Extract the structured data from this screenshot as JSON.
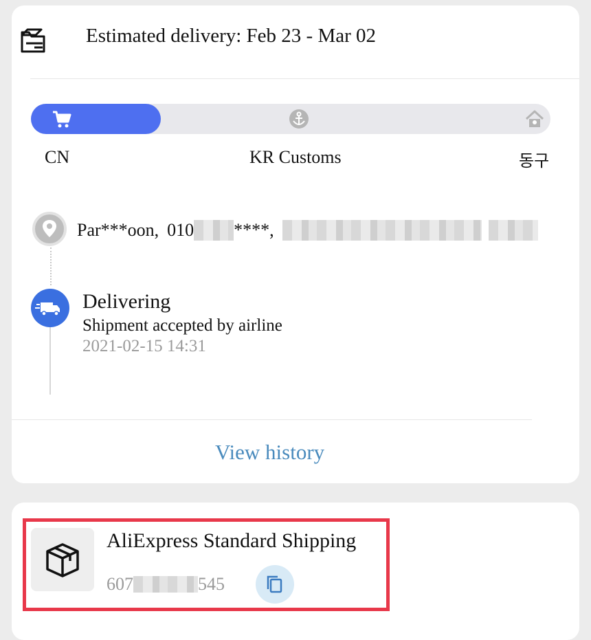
{
  "header": {
    "icon": "delivery-box-icon",
    "estimated_delivery": "Estimated delivery: Feb 23 - Mar 02"
  },
  "progress": {
    "fraction_complete": 0.25,
    "accent_color": "#4e6ff0",
    "stages": [
      {
        "label": "CN",
        "icon": "cart-icon"
      },
      {
        "label": "KR Customs",
        "icon": "anchor-icon"
      },
      {
        "label": "동구",
        "icon": "home-icon"
      }
    ]
  },
  "address": {
    "icon": "location-pin-icon",
    "name": "Par***oon,",
    "phone_prefix": "010",
    "phone_suffix": "****,"
  },
  "status": {
    "icon": "truck-icon",
    "title": "Delivering",
    "description": "Shipment accepted by airline",
    "timestamp": "2021-02-15 14:31"
  },
  "actions": {
    "view_history": "View history"
  },
  "shipping": {
    "icon": "package-icon",
    "method": "AliExpress Standard Shipping",
    "tracking_prefix": "607",
    "tracking_suffix": "545",
    "copy_icon": "copy-icon",
    "highlight_color": "#e8384a"
  }
}
